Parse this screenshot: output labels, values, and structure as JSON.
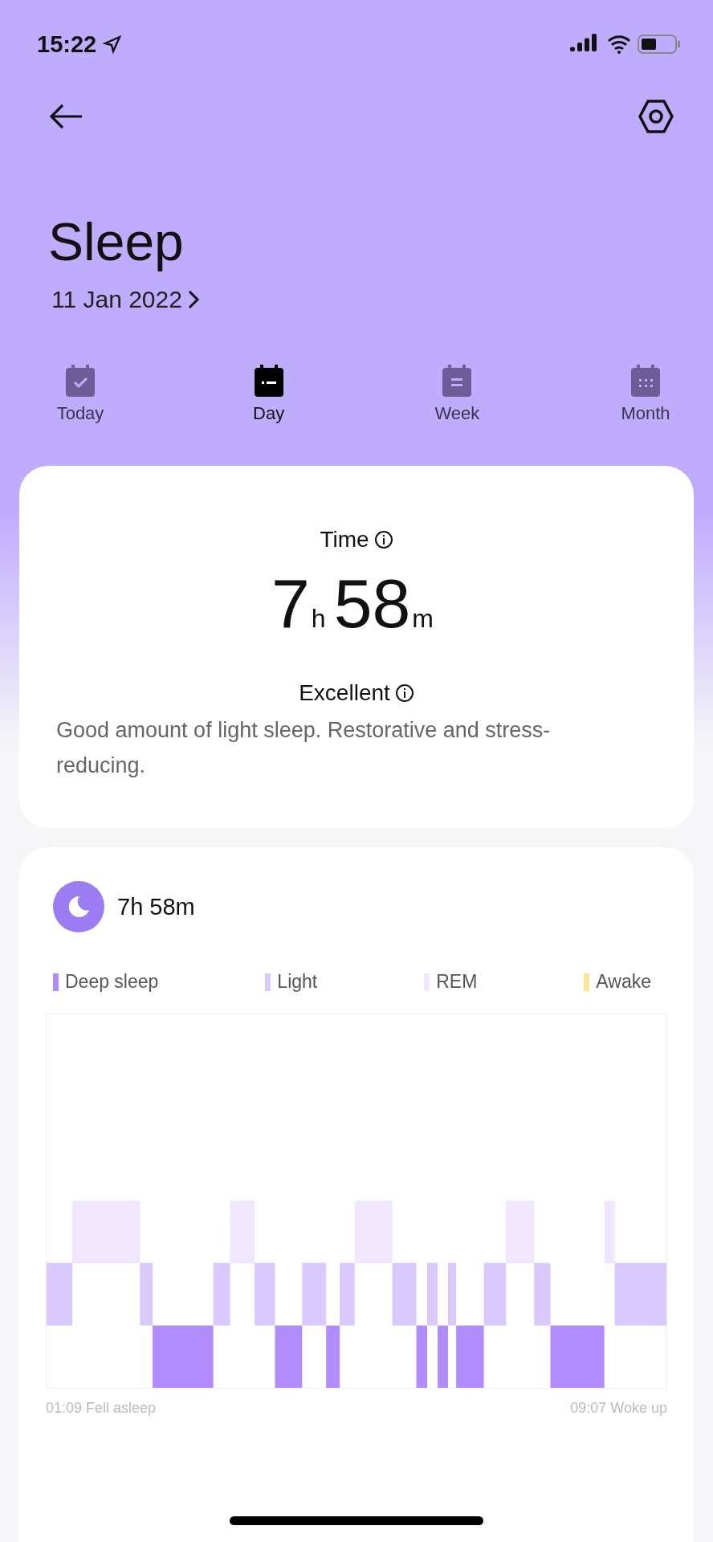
{
  "status_bar": {
    "time": "15:22"
  },
  "header": {
    "title": "Sleep",
    "date": "11 Jan 2022"
  },
  "tabs": [
    {
      "label": "Today",
      "kind": "check",
      "selected": false
    },
    {
      "label": "Day",
      "kind": "day",
      "selected": true
    },
    {
      "label": "Week",
      "kind": "week",
      "selected": false
    },
    {
      "label": "Month",
      "kind": "month",
      "selected": false
    }
  ],
  "summary": {
    "label": "Time",
    "hours": "7",
    "hours_unit": "h",
    "minutes": "58",
    "minutes_unit": "m",
    "rating": "Excellent",
    "description": "Good amount of light sleep. Restorative and stress-reducing."
  },
  "stages": {
    "total": "7h 58m",
    "legend": [
      {
        "label": "Deep sleep",
        "color": "#b18cfc"
      },
      {
        "label": "Light",
        "color": "#d9c9fd"
      },
      {
        "label": "REM",
        "color": "#f0e7fe"
      },
      {
        "label": "Awake",
        "color": "#fde59a"
      }
    ],
    "start_label": "01:09 Fell asleep",
    "end_label": "09:07 Woke up"
  }
}
